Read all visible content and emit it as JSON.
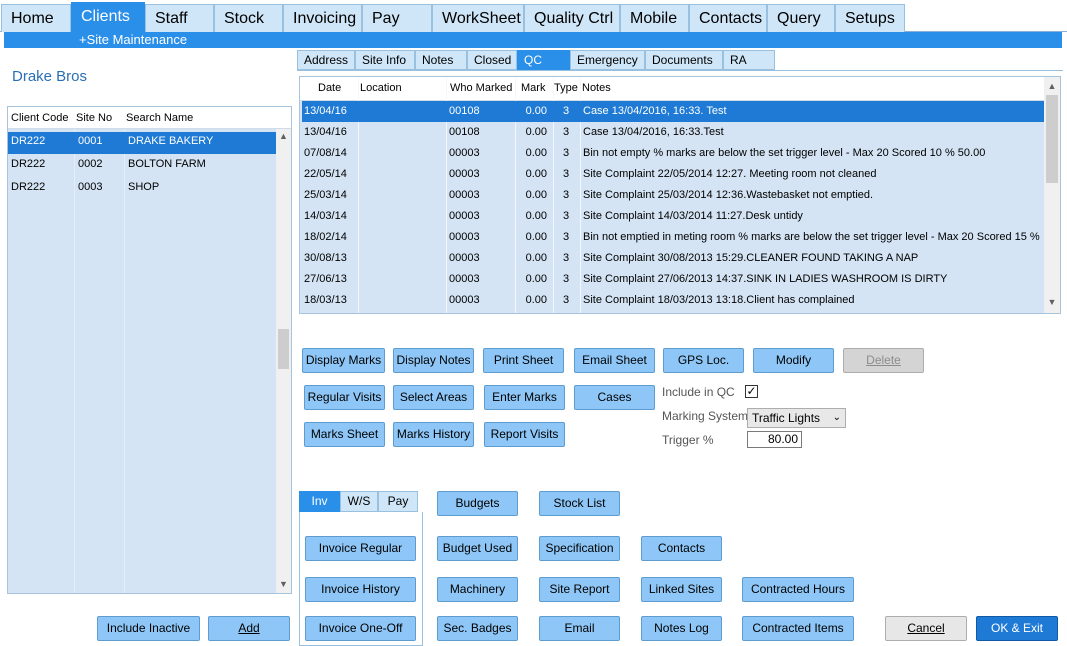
{
  "nav": {
    "tabs": [
      "Home",
      "Clients",
      "Staff",
      "Stock",
      "Invoicing",
      "Pay",
      "WorkSheet",
      "Quality Ctrl",
      "Mobile",
      "Contacts",
      "Query",
      "Setups"
    ],
    "active": "Clients"
  },
  "sub_bar": {
    "label": "+Site Maintenance"
  },
  "client": {
    "name": "Drake Bros"
  },
  "sites": {
    "columns": [
      "Client Code",
      "Site No",
      "Search Name"
    ],
    "rows": [
      [
        "DR222",
        "0001",
        "DRAKE BAKERY"
      ],
      [
        "DR222",
        "0002",
        "BOLTON FARM"
      ],
      [
        "DR222",
        "0003",
        "SHOP"
      ]
    ],
    "selected_index": 0
  },
  "detail_tabs": {
    "items": [
      "Address",
      "Site Info",
      "Notes",
      "Closed",
      "QC",
      "Emergency",
      "Documents",
      "RA"
    ],
    "active": "QC"
  },
  "qc": {
    "columns": [
      "Date",
      "Location",
      "Who Marked",
      "Mark",
      "Type",
      "Notes"
    ],
    "rows": [
      [
        "13/04/16",
        "",
        "00108",
        "0.00",
        "3",
        "Case 13/04/2016, 16:33. Test"
      ],
      [
        "13/04/16",
        "",
        "00108",
        "0.00",
        "3",
        "Case 13/04/2016, 16:33.Test"
      ],
      [
        "07/08/14",
        "",
        "00003",
        "0.00",
        "3",
        "Bin not empty % marks are below the set trigger level - Max 20 Scored 10 % 50.00"
      ],
      [
        "22/05/14",
        "",
        "00003",
        "0.00",
        "3",
        "Site Complaint 22/05/2014 12:27. Meeting room not cleaned"
      ],
      [
        "25/03/14",
        "",
        "00003",
        "0.00",
        "3",
        "Site Complaint 25/03/2014 12:36.Wastebasket not emptied."
      ],
      [
        "14/03/14",
        "",
        "00003",
        "0.00",
        "3",
        "Site Complaint 14/03/2014 11:27.Desk untidy"
      ],
      [
        "18/02/14",
        "",
        "00003",
        "0.00",
        "3",
        "Bin not emptied in meting room % marks are below the set trigger level - Max 20 Scored 15 %"
      ],
      [
        "30/08/13",
        "",
        "00003",
        "0.00",
        "3",
        "Site Complaint 30/08/2013 15:29.CLEANER FOUND TAKING  A NAP"
      ],
      [
        "27/06/13",
        "",
        "00003",
        "0.00",
        "3",
        "Site Complaint 27/06/2013 14:37.SINK IN LADIES WASHROOM IS DIRTY"
      ],
      [
        "18/03/13",
        "",
        "00003",
        "0.00",
        "3",
        "Site Complaint 18/03/2013 13:18.Client has complained"
      ]
    ],
    "selected_index": 0
  },
  "qc_buttons": {
    "display_marks": "Display Marks",
    "display_notes": "Display Notes",
    "print_sheet": "Print Sheet",
    "email_sheet": "Email Sheet",
    "gps_loc": "GPS Loc.",
    "modify": "Modify",
    "delete": "Delete",
    "regular_visits": "Regular Visits",
    "select_areas": "Select Areas",
    "enter_marks": "Enter Marks",
    "cases": "Cases",
    "marks_sheet": "Marks Sheet",
    "marks_history": "Marks History",
    "report_visits": "Report Visits"
  },
  "qc_settings": {
    "include_in_qc_label": "Include in QC",
    "include_in_qc_checked": true,
    "check_glyph": "✓",
    "marking_system_label": "Marking System",
    "marking_system_value": "Traffic Lights",
    "trigger_label": "Trigger %",
    "trigger_value": "80.00"
  },
  "bottom_tabs": {
    "items": [
      "Inv",
      "W/S",
      "Pay"
    ],
    "active": "Inv"
  },
  "inv_buttons": {
    "invoice_regular": "Invoice Regular",
    "invoice_history": "Invoice History",
    "invoice_one_off": "Invoice One-Off"
  },
  "site_buttons": {
    "budgets": "Budgets",
    "stock_list": "Stock List",
    "budget_used": "Budget Used",
    "specification": "Specification",
    "contacts": "Contacts",
    "machinery": "Machinery",
    "site_report": "Site Report",
    "linked_sites": "Linked Sites",
    "contracted_hours": "Contracted Hours",
    "sec_badges": "Sec. Badges",
    "email": "Email",
    "notes_log": "Notes Log",
    "contracted_items": "Contracted Items"
  },
  "footer": {
    "include_inactive": "Include Inactive",
    "add": "Add",
    "cancel": "Cancel",
    "ok_exit": "OK & Exit"
  },
  "colors": {
    "accent": "#2a8fe8",
    "selection": "#1e7ad4",
    "tab": "#cfe6f8",
    "button": "#8ec7f7",
    "grid": "#d4e4f4"
  }
}
